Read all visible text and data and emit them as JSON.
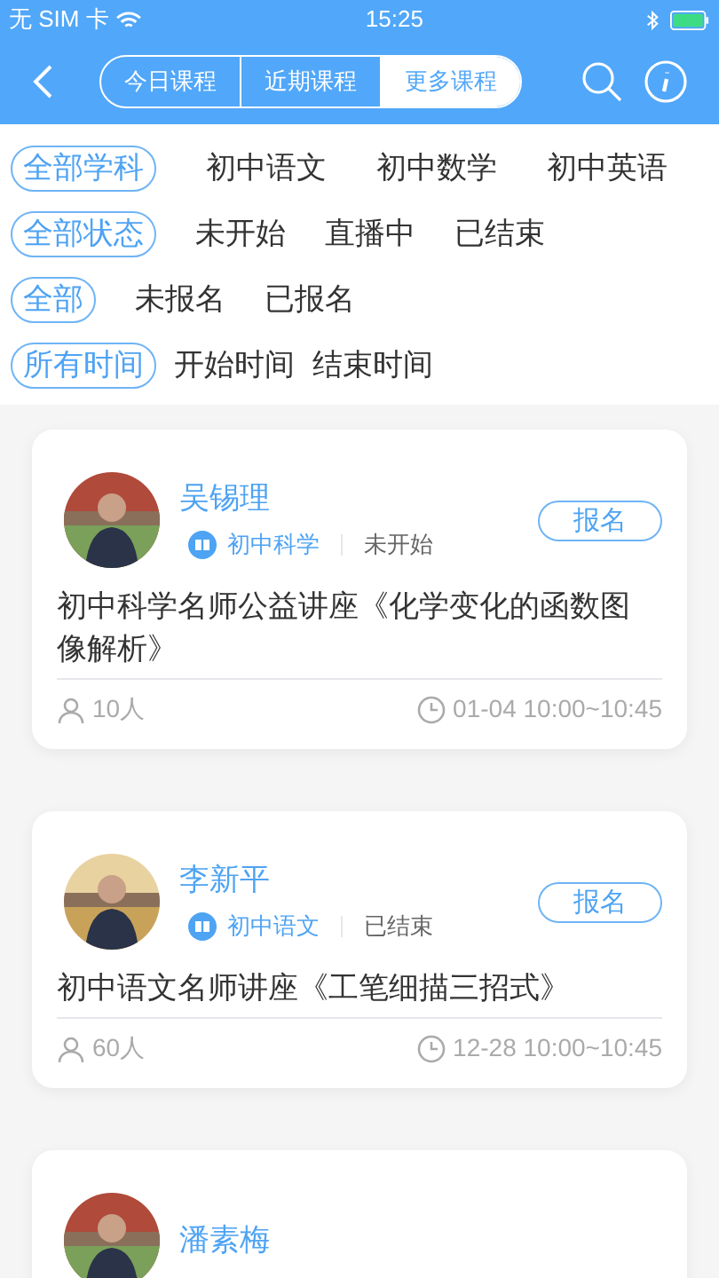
{
  "status_bar": {
    "carrier": "无 SIM 卡",
    "time": "15:25"
  },
  "nav": {
    "tabs": [
      {
        "label": "今日课程",
        "selected": false
      },
      {
        "label": "近期课程",
        "selected": false
      },
      {
        "label": "更多课程",
        "selected": true
      }
    ]
  },
  "filters": [
    {
      "options": [
        {
          "label": "全部学科",
          "selected": true
        },
        {
          "label": "初中语文",
          "selected": false
        },
        {
          "label": "初中数学",
          "selected": false
        },
        {
          "label": "初中英语",
          "selected": false
        }
      ]
    },
    {
      "options": [
        {
          "label": "全部状态",
          "selected": true
        },
        {
          "label": "未开始",
          "selected": false
        },
        {
          "label": "直播中",
          "selected": false
        },
        {
          "label": "已结束",
          "selected": false
        }
      ]
    },
    {
      "options": [
        {
          "label": "全部",
          "selected": true
        },
        {
          "label": "未报名",
          "selected": false
        },
        {
          "label": "已报名",
          "selected": false
        }
      ]
    },
    {
      "options": [
        {
          "label": "所有时间",
          "selected": true
        },
        {
          "label": "开始时间",
          "selected": false
        },
        {
          "label": "结束时间",
          "selected": false
        }
      ]
    }
  ],
  "courses": [
    {
      "teacher": "吴锡理",
      "subject": "初中科学",
      "status": "未开始",
      "button": "报名",
      "title": "初中科学名师公益讲座《化学变化的函数图像解析》",
      "count": "10人",
      "time": "01-04 10:00~10:45"
    },
    {
      "teacher": "李新平",
      "subject": "初中语文",
      "status": "已结束",
      "button": "报名",
      "title": "初中语文名师讲座《工笔细描三招式》",
      "count": "60人",
      "time": "12-28 10:00~10:45"
    },
    {
      "teacher": "潘素梅"
    }
  ]
}
